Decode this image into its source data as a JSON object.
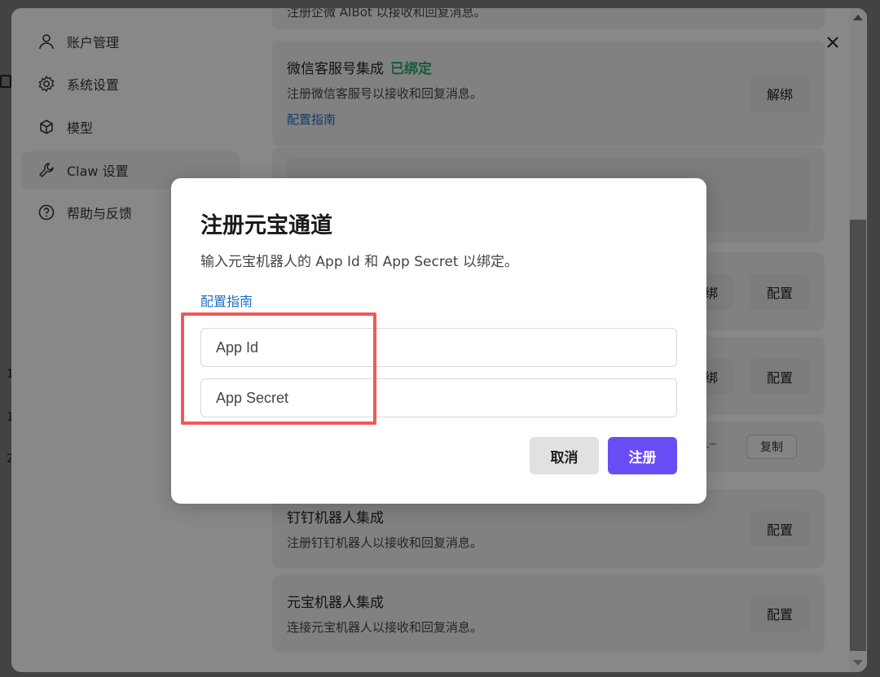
{
  "backdrop": {
    "nums": [
      "1",
      "1",
      "2"
    ]
  },
  "sidebar": {
    "items": [
      {
        "label": "账户管理",
        "icon": "user-icon"
      },
      {
        "label": "系统设置",
        "icon": "gear-icon"
      },
      {
        "label": "模型",
        "icon": "cube-icon"
      },
      {
        "label": "Claw 设置",
        "icon": "wrench-icon",
        "active": true
      },
      {
        "label": "帮助与反馈",
        "icon": "help-icon"
      }
    ]
  },
  "content": {
    "top_partial_text": "注册企微 AIBot 以接收和回复消息。",
    "wechat_card": {
      "title": "微信客服号集成",
      "status": "已绑定",
      "desc": "注册微信客服号以接收和回复消息。",
      "link": "配置指南",
      "unbind_label": "解绑"
    },
    "row_buttons": [
      {
        "unbind": "解绑",
        "config": "配置"
      },
      {
        "unbind": "解绑",
        "config": "配置"
      }
    ],
    "code_row": {
      "code_fragment": "ei⋯",
      "copy_label": "复制"
    },
    "dingtalk_card": {
      "title": "钉钉机器人集成",
      "desc": "注册钉钉机器人以接收和回复消息。",
      "config_label": "配置"
    },
    "yuanbao_card": {
      "title": "元宝机器人集成",
      "desc": "连接元宝机器人以接收和回复消息。",
      "config_label": "配置"
    }
  },
  "dialog": {
    "title": "注册元宝通道",
    "desc": "输入元宝机器人的 App Id 和 App Secret 以绑定。",
    "link": "配置指南",
    "app_id_placeholder": "App Id",
    "app_secret_placeholder": "App Secret",
    "cancel_label": "取消",
    "submit_label": "注册"
  },
  "colors": {
    "accent": "#6a4cf5",
    "status_green": "#2fa26b",
    "link": "#1d6fc2",
    "annotation": "#f05a5a"
  }
}
